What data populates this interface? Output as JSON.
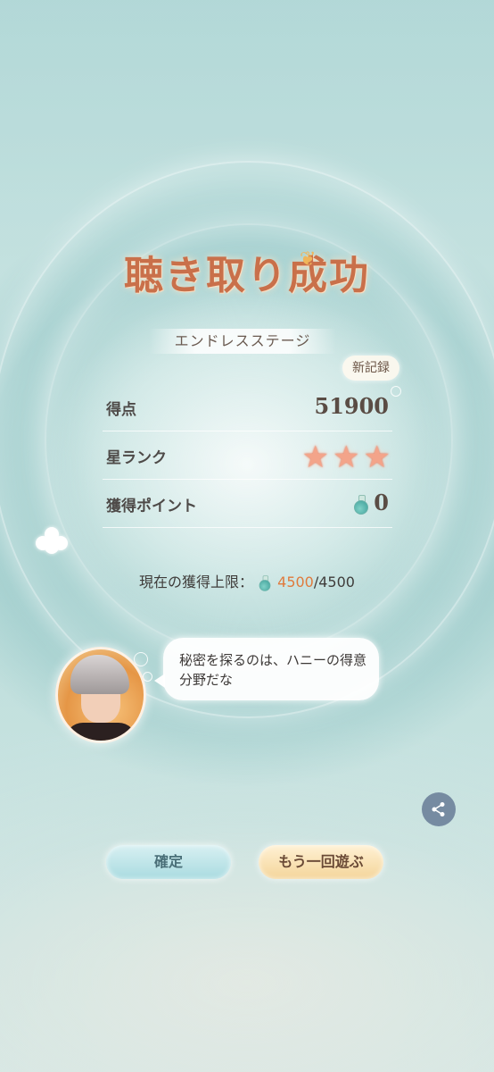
{
  "result": {
    "title": "聴き取り成功",
    "subtitle": "エンドレスステージ",
    "badge": "新記録",
    "score": {
      "label": "得点",
      "value": "51900"
    },
    "rank": {
      "label": "星ランク",
      "stars": 3
    },
    "points": {
      "label": "獲得ポイント",
      "value": "0"
    },
    "limit": {
      "label": "現在の獲得上限：",
      "current": "4500",
      "separator": "/",
      "max": "4500"
    }
  },
  "dialogue": {
    "text": "秘密を探るのは、ハニーの得意分野だな"
  },
  "buttons": {
    "confirm_label": "確定",
    "retry_label": "もう一回遊ぶ"
  },
  "icons": {
    "share": "share-icon",
    "star": "star-icon",
    "bottle": "bottle-icon"
  },
  "colors": {
    "title": "#c9704a",
    "accent_orange": "#e07a3c",
    "star": "#f3a48a",
    "confirm_btn": "#a9dbe0",
    "retry_btn": "#f4d59a"
  }
}
